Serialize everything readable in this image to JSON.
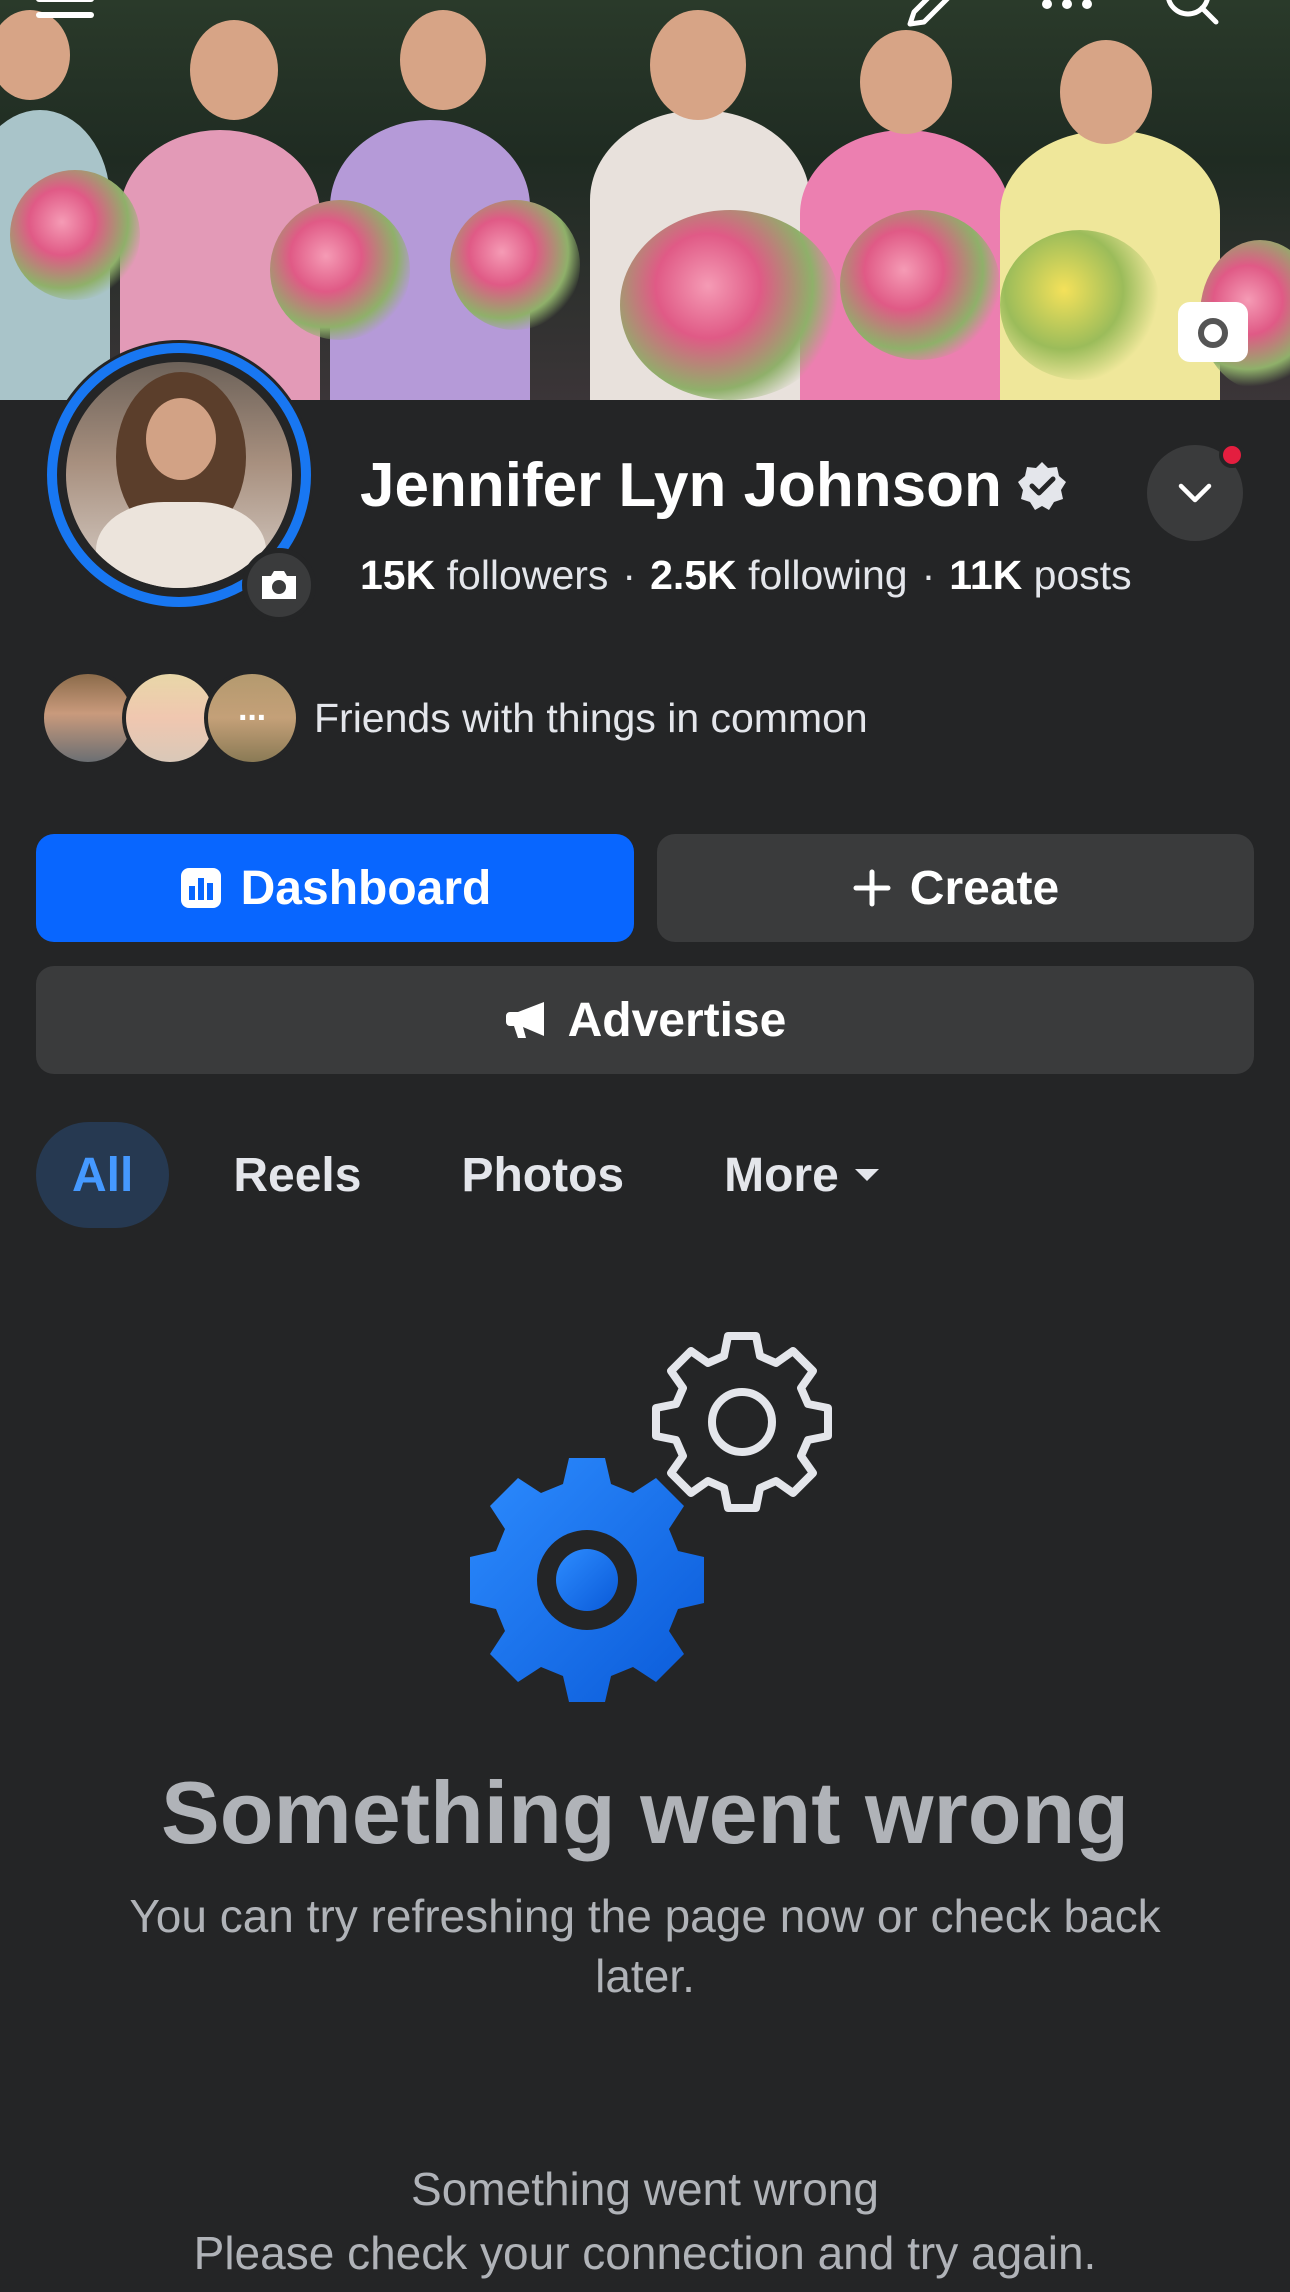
{
  "header": {
    "icons": [
      "menu-icon",
      "edit-icon",
      "more-icon",
      "search-icon"
    ]
  },
  "profile": {
    "name": "Jennifer Lyn Johnson",
    "followers_count": "15K",
    "followers_label": "followers",
    "following_count": "2.5K",
    "following_label": "following",
    "posts_count": "11K",
    "posts_label": "posts",
    "separator": "·",
    "friends_text": "Friends with things in common",
    "friends_more_glyph": "···"
  },
  "actions": {
    "dashboard_label": "Dashboard",
    "create_label": "Create",
    "advertise_label": "Advertise"
  },
  "tabs": [
    {
      "label": "All",
      "active": true
    },
    {
      "label": "Reels",
      "active": false
    },
    {
      "label": "Photos",
      "active": false
    },
    {
      "label": "More",
      "active": false
    }
  ],
  "error": {
    "title": "Something went wrong",
    "description": "You can try refreshing the page now or check back later.",
    "secondary_title": "Something went wrong",
    "secondary_description": "Please check your connection and try again."
  },
  "colors": {
    "background": "#242526",
    "accent": "#0866ff",
    "button_secondary": "#3a3b3c",
    "active_tab_bg": "#263951",
    "active_tab_text": "#4599ff",
    "notification_dot": "#e41e3f"
  }
}
